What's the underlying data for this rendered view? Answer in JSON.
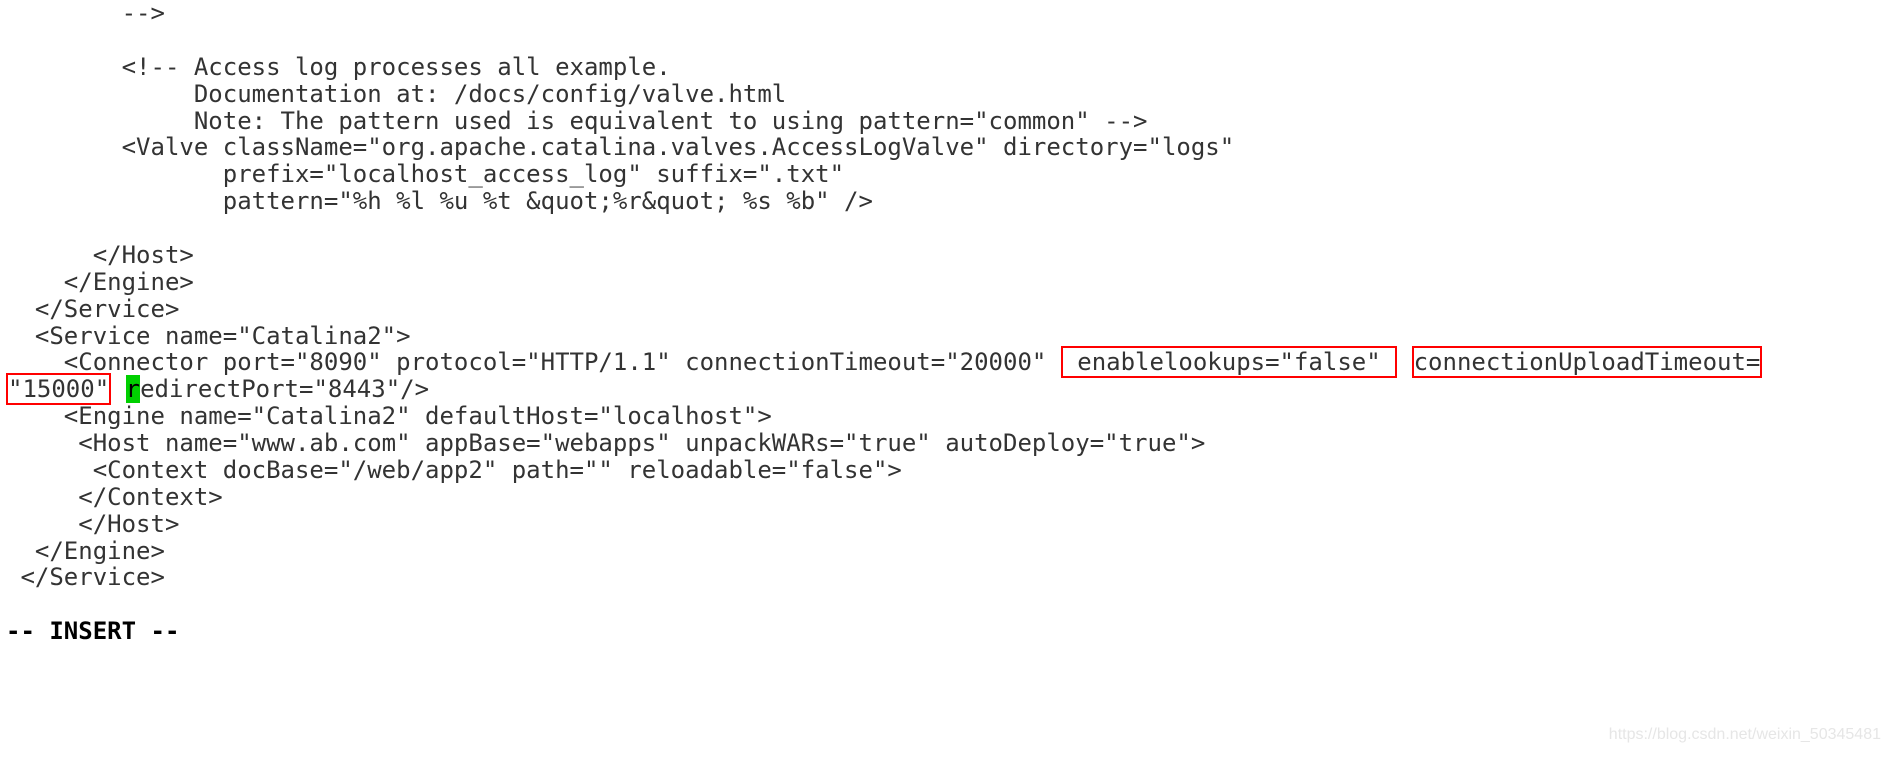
{
  "lines": {
    "l0": "        -->",
    "l1": "",
    "l2": "        <!-- Access log processes all example.",
    "l3": "             Documentation at: /docs/config/valve.html",
    "l4": "             Note: The pattern used is equivalent to using pattern=\"common\" -->",
    "l5": "        <Valve className=\"org.apache.catalina.valves.AccessLogValve\" directory=\"logs\"",
    "l6": "               prefix=\"localhost_access_log\" suffix=\".txt\"",
    "l7": "               pattern=\"%h %l %u %t &quot;%r&quot; %s %b\" />",
    "l8": "",
    "l9": "      </Host>",
    "l10": "    </Engine>",
    "l11": "  </Service>",
    "l12": "  <Service name=\"Catalina2\">",
    "l13_pre": "    <Connector port=\"8090\" protocol=\"HTTP/1.1\" connectionTimeout=\"20000\" ",
    "l13_box1": " enablelookups=\"false\" ",
    "l13_mid": " ",
    "l13_box2a": "connectionUploadTimeout=",
    "l13_box2b": "\"15000\"",
    "l13_cursor": "r",
    "l13_post": "edirectPort=\"8443\"/>",
    "l14": "    <Engine name=\"Catalina2\" defaultHost=\"localhost\">",
    "l15": "     <Host name=\"www.ab.com\" appBase=\"webapps\" unpackWARs=\"true\" autoDeploy=\"true\">",
    "l16": "      <Context docBase=\"/web/app2\" path=\"\" reloadable=\"false\">",
    "l17": "     </Context>",
    "l18": "     </Host>",
    "l19": "  </Engine>",
    "l20": " </Service>",
    "l21": ""
  },
  "status": "-- INSERT --",
  "watermark": "https://blog.csdn.net/weixin_50345481"
}
